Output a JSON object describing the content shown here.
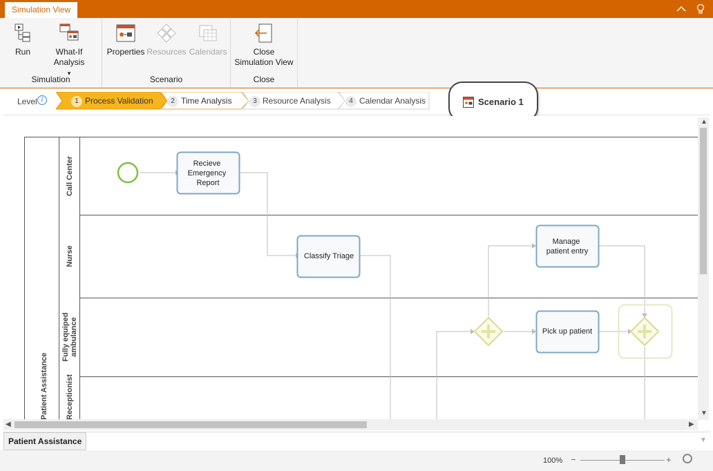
{
  "window": {
    "tab_title": "Simulation View"
  },
  "ribbon": {
    "groups": [
      {
        "title": "Simulation",
        "buttons": [
          {
            "label": "Run"
          },
          {
            "label": "What-If Analysis",
            "dropdown": "▾"
          }
        ]
      },
      {
        "title": "Scenario",
        "buttons": [
          {
            "label": "Properties"
          },
          {
            "label": "Resources",
            "disabled": true
          },
          {
            "label": "Calendars",
            "disabled": true
          }
        ]
      },
      {
        "title": "Close",
        "buttons": [
          {
            "label_line1": "Close",
            "label_line2": "Simulation View"
          }
        ]
      }
    ]
  },
  "levelbar": {
    "label": "Level",
    "steps": [
      {
        "num": "1",
        "label": "Process Validation",
        "active": true
      },
      {
        "num": "2",
        "label": "Time Analysis"
      },
      {
        "num": "3",
        "label": "Resource Analysis"
      },
      {
        "num": "4",
        "label": "Calendar Analysis"
      }
    ],
    "scenario": "Scenario 1"
  },
  "diagram": {
    "pool_label": "Patient Assistance",
    "lanes": [
      "Call Center",
      "Nurse",
      "Fully equiped ambulance",
      "Receptionist"
    ],
    "tasks": [
      {
        "label": "Recieve Emergency Report",
        "lines": [
          "Recieve",
          "Emergency",
          "Report"
        ]
      },
      {
        "label": "Classify Triage",
        "lines": [
          "Classify Triage"
        ]
      },
      {
        "label": "Manage patient entry",
        "lines": [
          "Manage",
          "patient entry"
        ]
      },
      {
        "label": "Pick up patient",
        "lines": [
          "Pick up patient"
        ]
      }
    ]
  },
  "sheet": {
    "tab": "Patient Assistance"
  },
  "status": {
    "zoom": "100%",
    "minus": "−",
    "plus": "+"
  },
  "colors": {
    "accent": "#d46400",
    "active_step": "#f6b51d",
    "task_border": "#7da7c4",
    "gateway": "#d9dc8e",
    "start_event": "#7cc243"
  }
}
